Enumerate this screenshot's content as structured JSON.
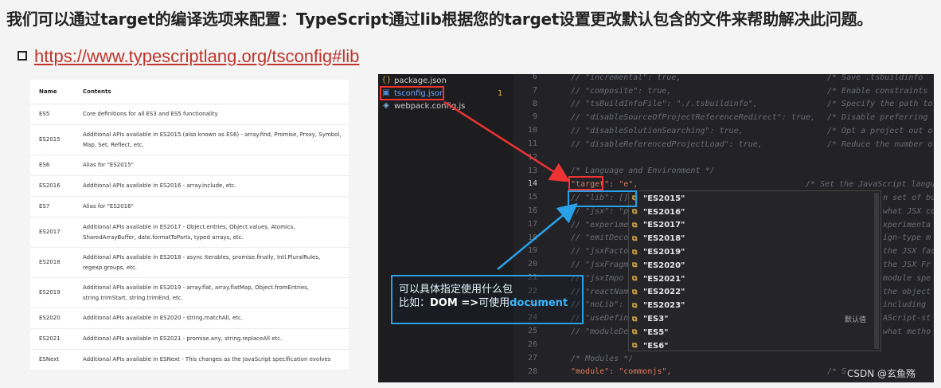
{
  "heading": "我们可以通过target的编译选项来配置：TypeScript通过lib根据您的target设置更改默认包含的文件来帮助解决此问题。",
  "link": "https://www.typescriptlang.org/tsconfig#lib",
  "table": {
    "col_name": "Name",
    "col_contents": "Contents",
    "rows": [
      {
        "name": "ES5",
        "contents": "Core definitions for all ES3 and ES5 functionality"
      },
      {
        "name": "ES2015",
        "contents": "Additional APIs available in ES2015 (also known as ES6) - array.find, Promise, Proxy, Symbol, Map, Set, Reflect, etc."
      },
      {
        "name": "ES6",
        "contents": "Alias for \"ES2015\""
      },
      {
        "name": "ES2016",
        "contents": "Additional APIs available in ES2016 - array.include, etc."
      },
      {
        "name": "ES7",
        "contents": "Alias for \"ES2016\""
      },
      {
        "name": "ES2017",
        "contents": "Additional APIs available in ES2017 - Object.entries, Object.values, Atomics, SharedArrayBuffer, date.formatToParts, typed arrays, etc."
      },
      {
        "name": "ES2018",
        "contents": "Additional APIs available in ES2018 - async iterables, promise.finally, Intl.PluralRules, regexp.groups, etc."
      },
      {
        "name": "ES2019",
        "contents": "Additional APIs available in ES2019 - array.flat, array.flatMap, Object.fromEntries, string.trimStart, string.trimEnd, etc."
      },
      {
        "name": "ES2020",
        "contents": "Additional APIs available in ES2020 - string.matchAll, etc."
      },
      {
        "name": "ES2021",
        "contents": "Additional APIs available in ES2021 - promise.any, string.replaceAll etc."
      },
      {
        "name": "ESNext",
        "contents": "Additional APIs available in ESNext - This changes as the JavaScript specification evolves"
      }
    ]
  },
  "explorer": {
    "files": [
      {
        "name": "package.json",
        "icon": "json-icon"
      },
      {
        "name": "tsconfig.json",
        "icon": "ts-icon",
        "badge": "1"
      },
      {
        "name": "webpack.config.js",
        "icon": "webpack-icon"
      }
    ]
  },
  "editor": {
    "line_numbers": [
      "6",
      "7",
      "8",
      "9",
      "10",
      "11",
      "12",
      "13",
      "14",
      "15",
      "16",
      "17",
      "18",
      "19",
      "20",
      "21",
      "22",
      "23",
      "24",
      "25",
      "26",
      "27",
      "28"
    ],
    "lines": [
      {
        "a": "// \"incremental\": true,",
        "b": "/* Save .tsbuildinfo"
      },
      {
        "a": "// \"composite\": true,",
        "b": "/* Enable constraints"
      },
      {
        "a": "// \"tsBuildInfoFile\": \"./.tsbuildinfo\",",
        "b": "/* Specify the path to"
      },
      {
        "a": "// \"disableSourceOfProjectReferenceRedirect\": true,",
        "b": "/* Disable preferring"
      },
      {
        "a": "// \"disableSolutionSearching\": true,",
        "b": "/* Opt a project out o"
      },
      {
        "a": "// \"disableReferencedProjectLoad\": true,",
        "b": "/* Reduce the number o"
      },
      {
        "a": "",
        "b": ""
      },
      {
        "a": "/* Language and Environment */",
        "b": ""
      },
      {
        "a": "\"target\": \"e\",",
        "b": "/* Set the JavaScript langu"
      },
      {
        "a": "// \"lib\": [],",
        "b": "n set of bu"
      },
      {
        "a": "// \"jsx\": \"p",
        "b": "what JSX co"
      },
      {
        "a": "// \"experime",
        "b": "xperimenta"
      },
      {
        "a": "// \"emitDeco",
        "b": "ign-type m"
      },
      {
        "a": "// \"jsxFacto",
        "b": "the JSX fac"
      },
      {
        "a": "// \"jsxFragm",
        "b": "the JSX Fr"
      },
      {
        "a": "// \"jsxImpo",
        "b": "module spe"
      },
      {
        "a": "// \"reactNam",
        "b": "the object"
      },
      {
        "a": "// \"noLib\":",
        "b": "including"
      },
      {
        "a": "// \"useDefin",
        "b": "AScript-st"
      },
      {
        "a": "// \"moduleDe",
        "b": "what metho"
      },
      {
        "a": "",
        "b": ""
      },
      {
        "a": "/* Modules */",
        "b": ""
      },
      {
        "a": "\"module\": \"commonjs\",",
        "b": "/* S"
      }
    ]
  },
  "suggest": {
    "items": [
      "\"ES2015\"",
      "\"ES2016\"",
      "\"ES2017\"",
      "\"ES2018\"",
      "\"ES2019\"",
      "\"ES2020\"",
      "\"ES2021\"",
      "\"ES2022\"",
      "\"ES2023\"",
      "\"ES3\"",
      "\"ES5\"",
      "\"ES6\""
    ],
    "hint": "默认值"
  },
  "callout": {
    "line1": "可以具体指定使用什么包",
    "line2_prefix": "比如：",
    "line2_bold": "DOM =>",
    "line2_mid": "可使用",
    "line2_end": "document"
  },
  "watermark": "CSDN @玄鱼殇",
  "colors": {
    "link": "#c0342c",
    "annotation_red": "#e33333",
    "annotation_blue": "#2aa0e8"
  }
}
